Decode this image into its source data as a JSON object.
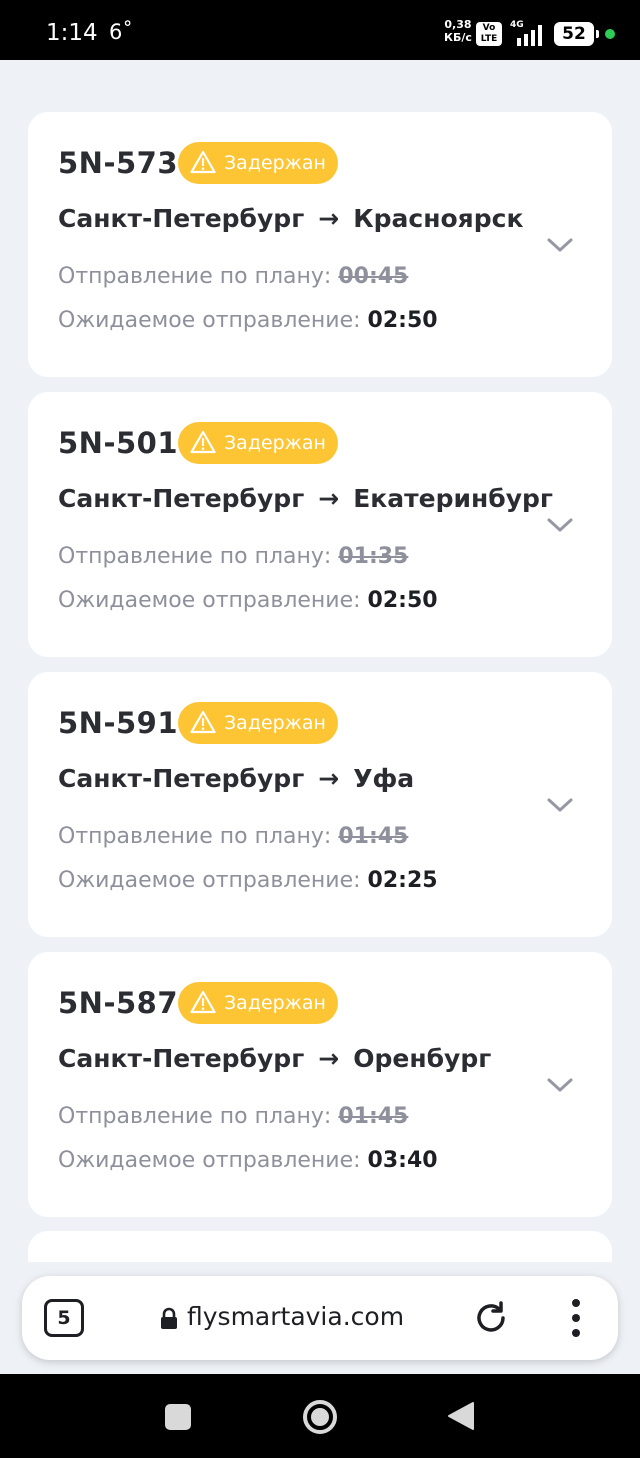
{
  "status_bar": {
    "time": "1:14",
    "temperature": "6˚",
    "net_speed_value": "0,38",
    "net_speed_unit": "КБ/с",
    "volte_top": "Vo",
    "volte_bottom": "LTE",
    "network": "4G",
    "battery": "52"
  },
  "flights": [
    {
      "number": "5N-573",
      "status": "Задержан",
      "from": "Санкт-Петербург",
      "arrow": "→",
      "to": "Красноярск",
      "planned_label": "Отправление по плану:",
      "planned_time": "00:45",
      "expected_label": "Ожидаемое отправление:",
      "expected_time": "02:50"
    },
    {
      "number": "5N-501",
      "status": "Задержан",
      "from": "Санкт-Петербург",
      "arrow": "→",
      "to": "Екатеринбург",
      "planned_label": "Отправление по плану:",
      "planned_time": "01:35",
      "expected_label": "Ожидаемое отправление:",
      "expected_time": "02:50"
    },
    {
      "number": "5N-591",
      "status": "Задержан",
      "from": "Санкт-Петербург",
      "arrow": "→",
      "to": "Уфа",
      "planned_label": "Отправление по плану:",
      "planned_time": "01:45",
      "expected_label": "Ожидаемое отправление:",
      "expected_time": "02:25"
    },
    {
      "number": "5N-587",
      "status": "Задержан",
      "from": "Санкт-Петербург",
      "arrow": "→",
      "to": "Оренбург",
      "planned_label": "Отправление по плану:",
      "planned_time": "01:45",
      "expected_label": "Ожидаемое отправление:",
      "expected_time": "03:40"
    }
  ],
  "browser": {
    "tab_count": "5",
    "url": "flysmartavia.com"
  },
  "colors": {
    "badge": "#fdc434",
    "background": "#eef1f6"
  },
  "icons": [
    "warning-icon",
    "chevron-down-icon",
    "lock-icon",
    "reload-icon",
    "more-vert-icon",
    "nav-recents-icon",
    "nav-home-icon",
    "nav-back-icon"
  ]
}
